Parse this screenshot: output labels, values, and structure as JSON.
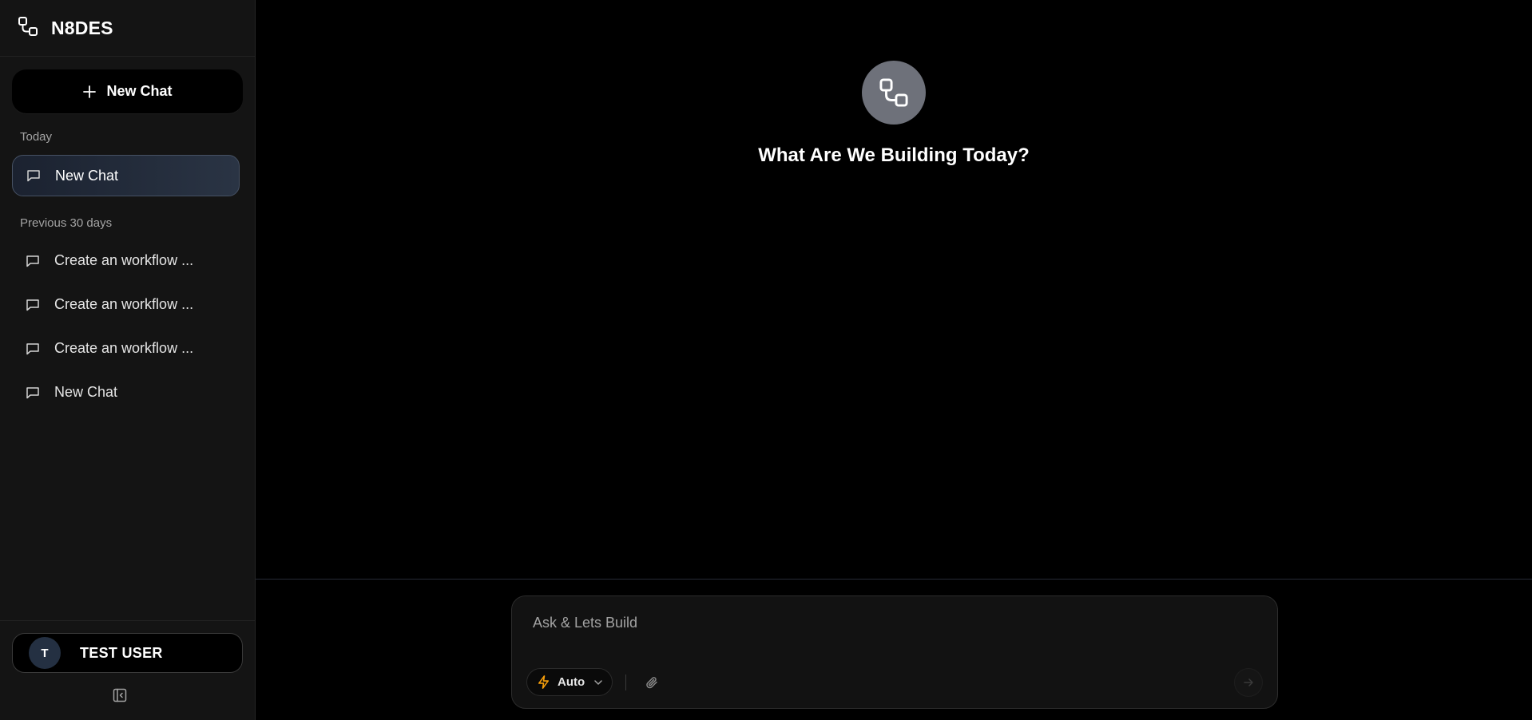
{
  "brand": {
    "name": "N8DES",
    "logo_icon": "workflow-nodes-icon"
  },
  "sidebar": {
    "new_chat_label": "New Chat",
    "sections": {
      "today_label": "Today",
      "previous_label": "Previous 30 days"
    },
    "today_items": [
      {
        "label": "New Chat",
        "active": true
      }
    ],
    "previous_items": [
      {
        "label": "Create an workflow ..."
      },
      {
        "label": "Create an workflow ..."
      },
      {
        "label": "Create an workflow ..."
      },
      {
        "label": "New Chat"
      }
    ],
    "user": {
      "initial": "T",
      "name": "TEST USER"
    }
  },
  "main": {
    "hero_title": "What Are We Building Today?",
    "composer": {
      "placeholder": "Ask & Lets Build",
      "value": "",
      "mode_label": "Auto"
    }
  },
  "colors": {
    "background": "#000000",
    "sidebar_bg": "#141414",
    "accent_bolt": "#f59e0b",
    "active_item_border": "#465163",
    "hero_logo_bg": "#6e717a"
  }
}
